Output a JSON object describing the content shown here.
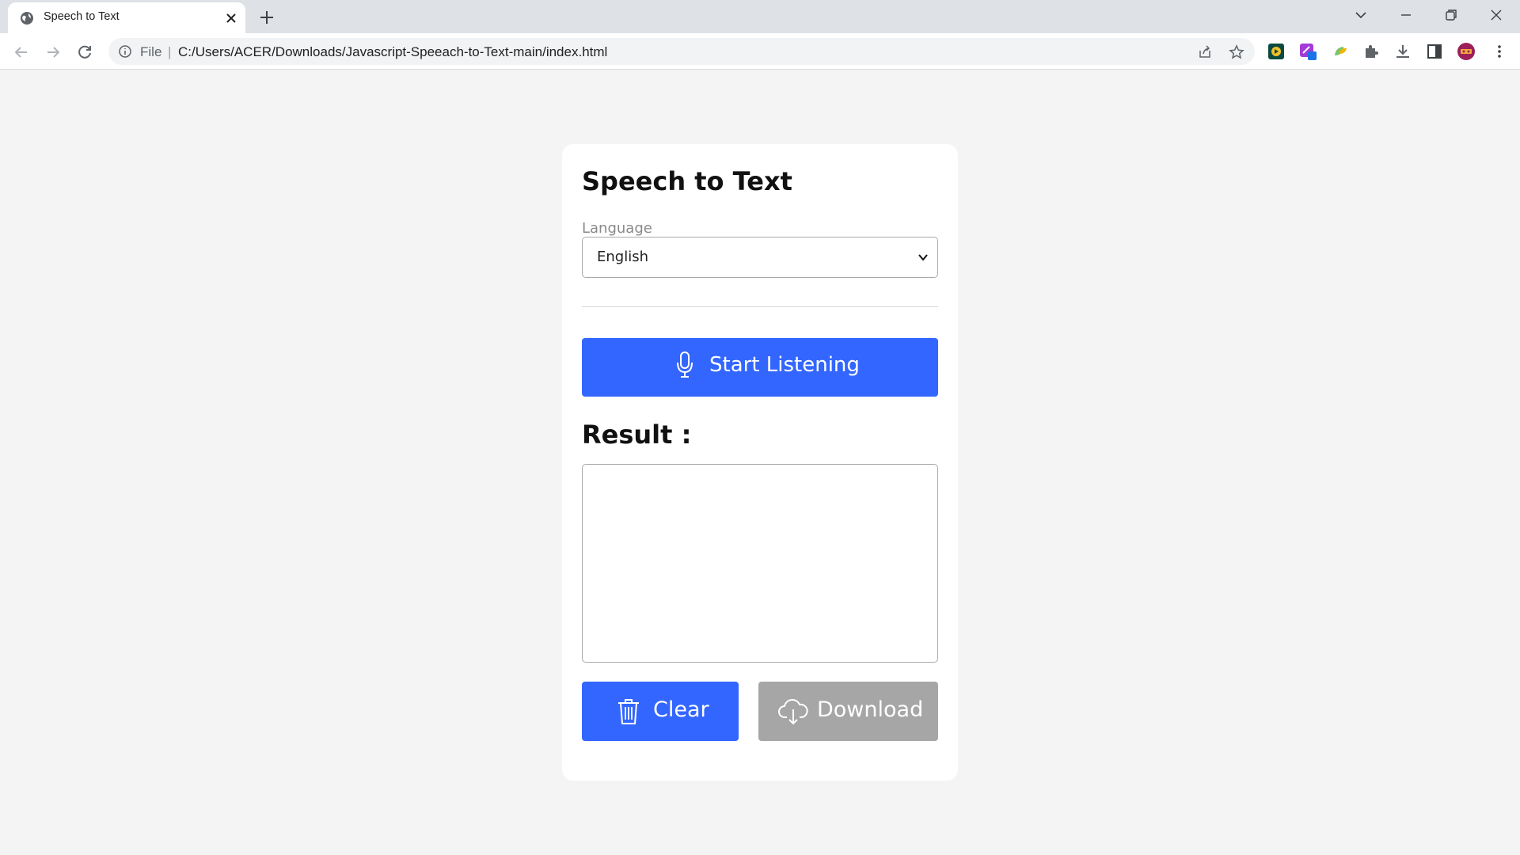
{
  "browser": {
    "tab_title": "Speech to Text",
    "address_scheme": "File",
    "address_separator": "|",
    "address_url": "C:/Users/ACER/Downloads/Javascript-Speeach-to-Text-main/index.html"
  },
  "page": {
    "title": "Speech to Text",
    "language_label": "Language",
    "language_selected": "English",
    "listen_button": "Start Listening",
    "result_label": "Result :",
    "result_text": "",
    "clear_button": "Clear",
    "download_button": "Download"
  },
  "colors": {
    "accent": "#3366ff",
    "disabled": "#a6a6a6",
    "page_background": "#f4f4f4"
  }
}
